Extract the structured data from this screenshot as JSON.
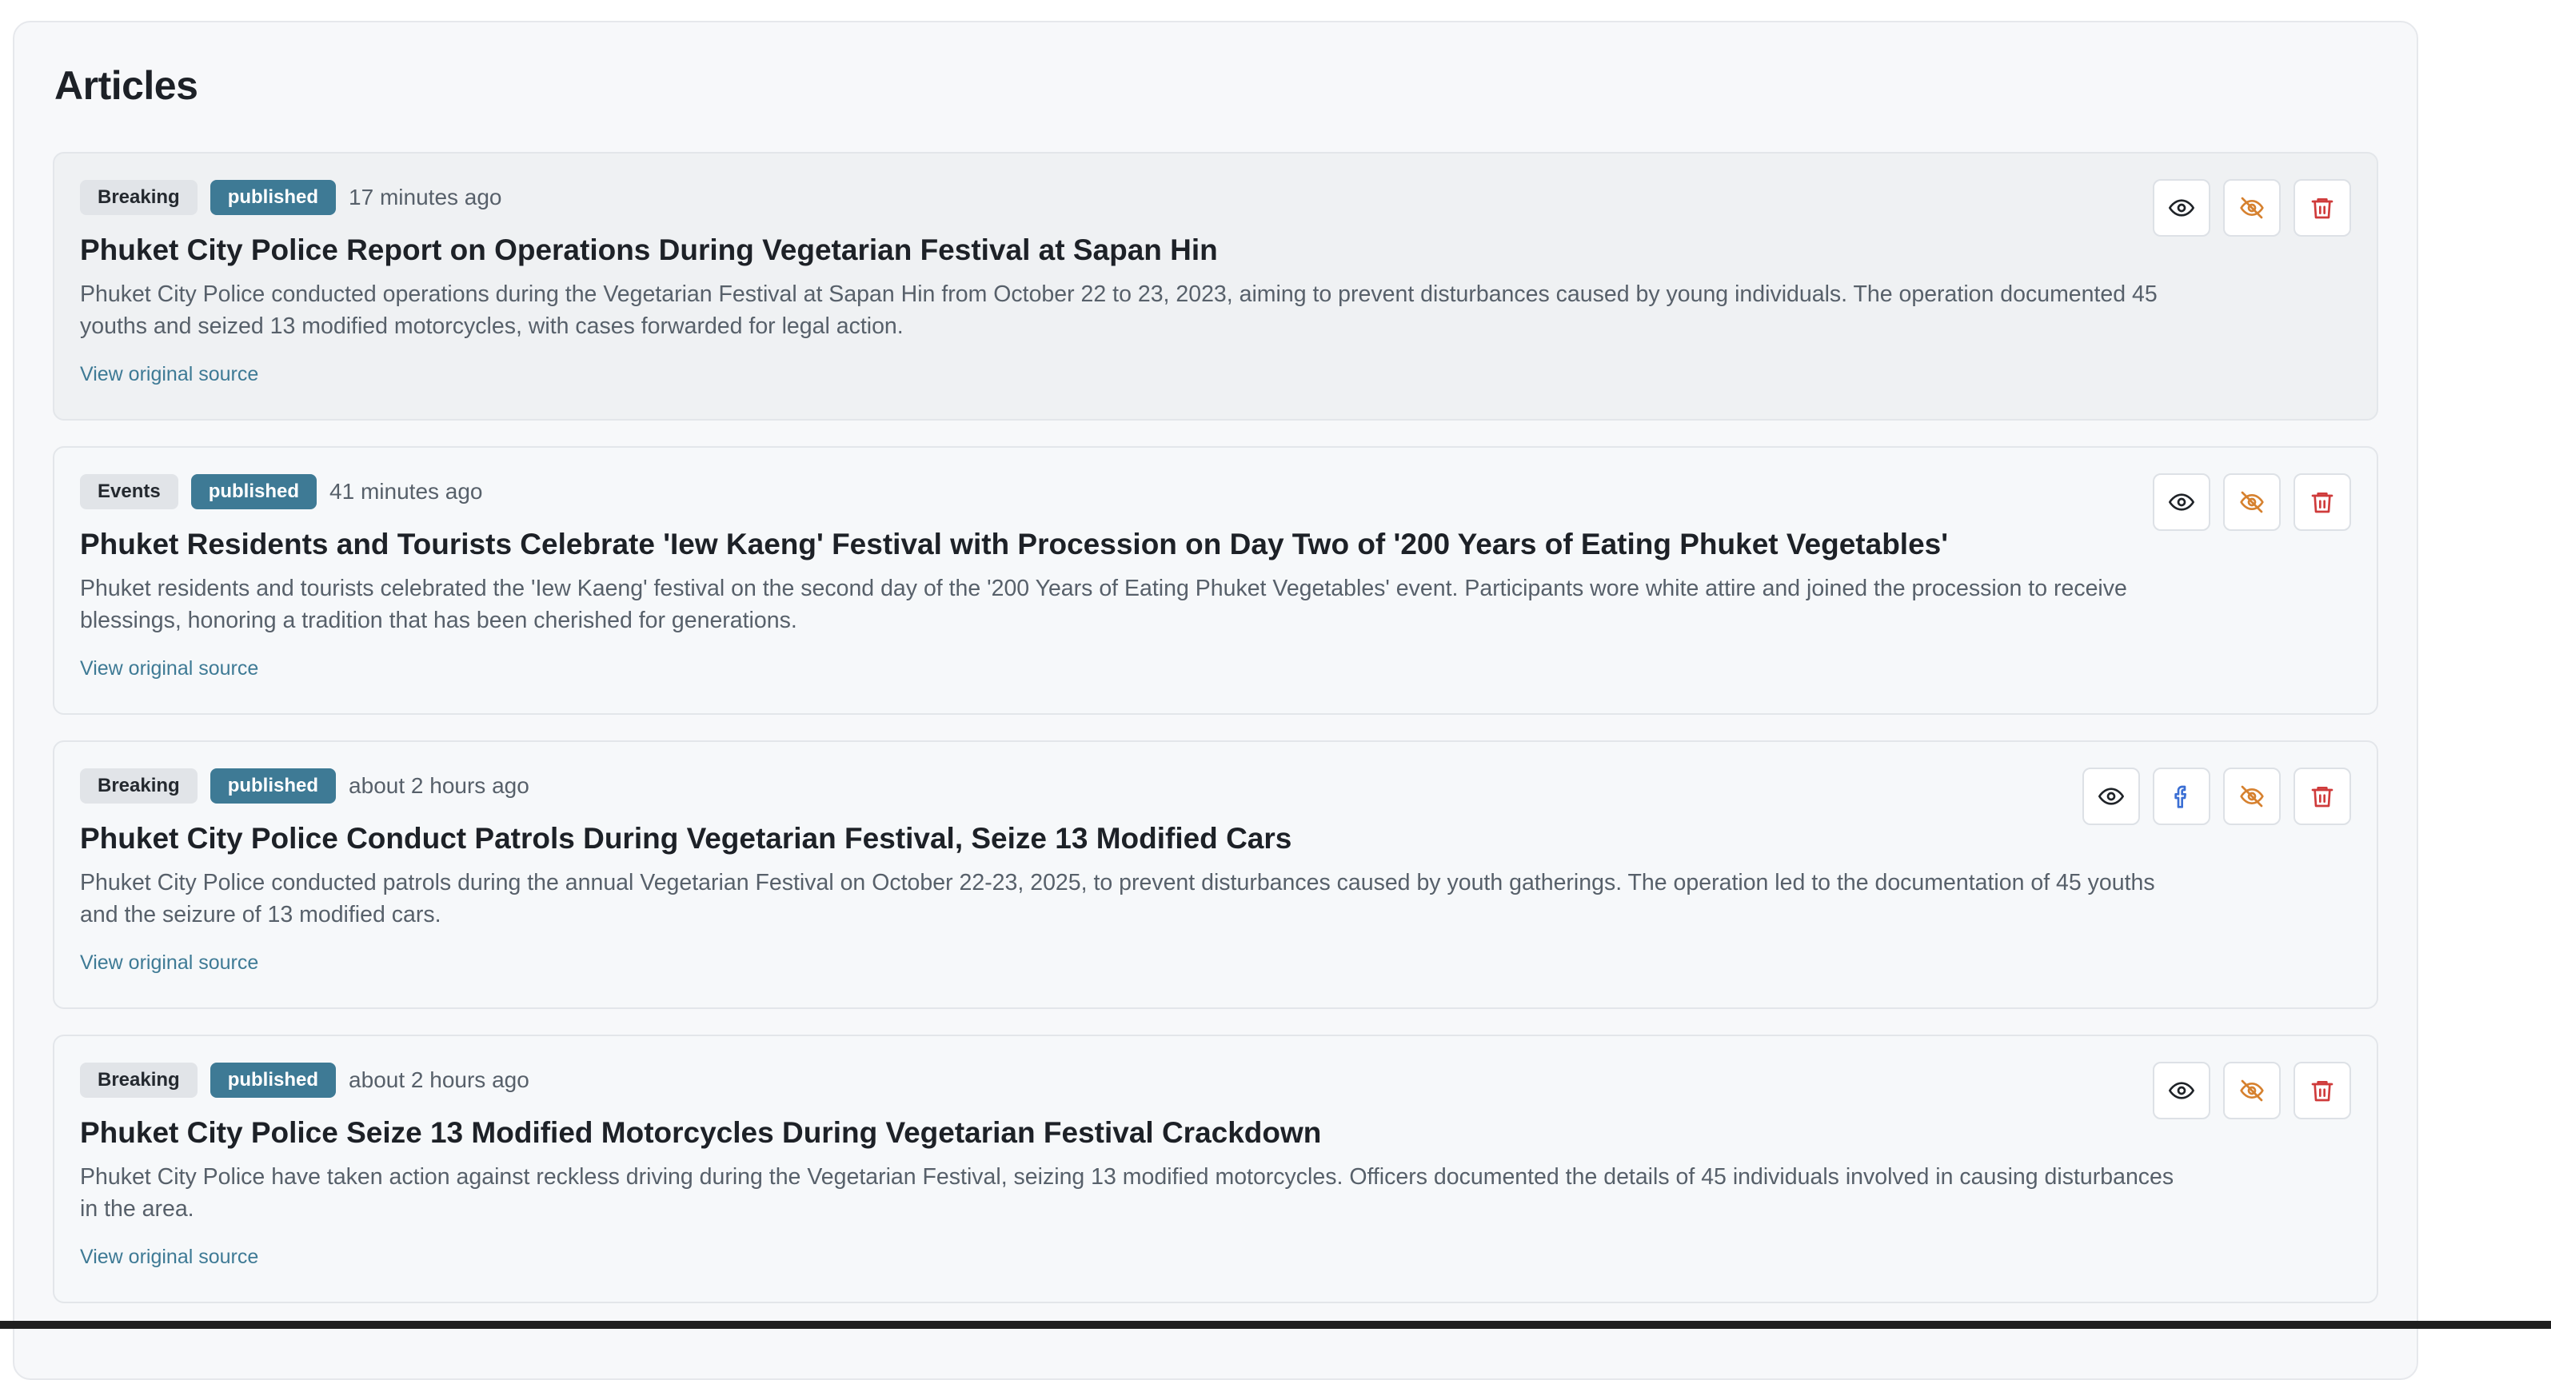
{
  "page": {
    "title": "Articles"
  },
  "colors": {
    "status_badge": "#3e7a95",
    "link": "#3e7a95",
    "hide_icon": "#d6812f",
    "delete_icon": "#cf3b3b",
    "facebook_icon": "#3b6fd4"
  },
  "articles": [
    {
      "category": "Breaking",
      "status": "published",
      "time": "17 minutes ago",
      "title": "Phuket City Police Report on Operations During Vegetarian Festival at Sapan Hin",
      "summary": "Phuket City Police conducted operations during the Vegetarian Festival at Sapan Hin from October 22 to 23, 2023, aiming to prevent disturbances caused by young individuals. The operation documented 45 youths and seized 13 modified motorcycles, with cases forwarded for legal action.",
      "link_label": "View original source",
      "icons": [
        "eye-icon",
        "eye-off-icon",
        "trash-icon"
      ]
    },
    {
      "category": "Events",
      "status": "published",
      "time": "41 minutes ago",
      "title": "Phuket Residents and Tourists Celebrate 'Iew Kaeng' Festival with Procession on Day Two of '200 Years of Eating Phuket Vegetables'",
      "summary": "Phuket residents and tourists celebrated the 'Iew Kaeng' festival on the second day of the '200 Years of Eating Phuket Vegetables' event. Participants wore white attire and joined the procession to receive blessings, honoring a tradition that has been cherished for generations.",
      "link_label": "View original source",
      "icons": [
        "eye-icon",
        "eye-off-icon",
        "trash-icon"
      ]
    },
    {
      "category": "Breaking",
      "status": "published",
      "time": "about 2 hours ago",
      "title": "Phuket City Police Conduct Patrols During Vegetarian Festival, Seize 13 Modified Cars",
      "summary": "Phuket City Police conducted patrols during the annual Vegetarian Festival on October 22-23, 2025, to prevent disturbances caused by youth gatherings. The operation led to the documentation of 45 youths and the seizure of 13 modified cars.",
      "link_label": "View original source",
      "icons": [
        "eye-icon",
        "facebook-icon",
        "eye-off-icon",
        "trash-icon"
      ]
    },
    {
      "category": "Breaking",
      "status": "published",
      "time": "about 2 hours ago",
      "title": "Phuket City Police Seize 13 Modified Motorcycles During Vegetarian Festival Crackdown",
      "summary": "Phuket City Police have taken action against reckless driving during the Vegetarian Festival, seizing 13 modified motorcycles. Officers documented the details of 45 individuals involved in causing disturbances in the area.",
      "link_label": "View original source",
      "icons": [
        "eye-icon",
        "eye-off-icon",
        "trash-icon"
      ]
    }
  ]
}
